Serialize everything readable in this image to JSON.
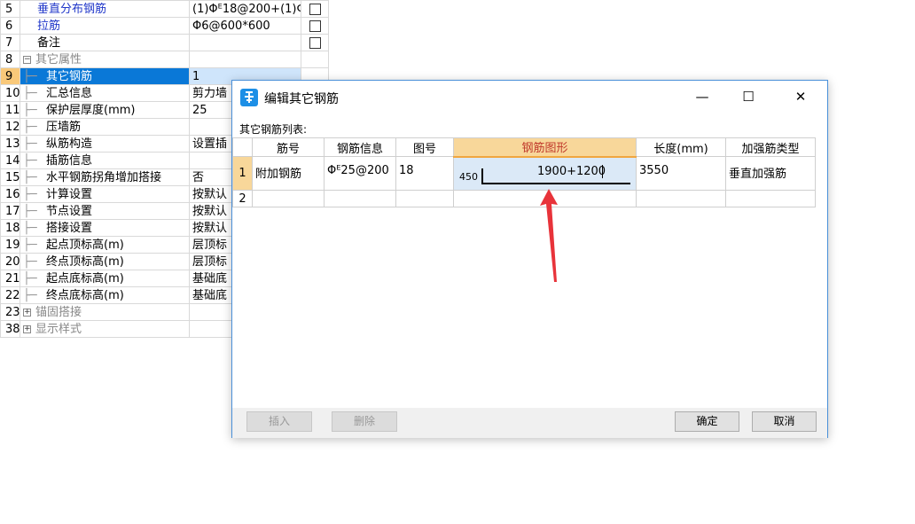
{
  "properties": [
    {
      "num": "5",
      "name": "垂直分布钢筋",
      "value": "(1)Φᴱ18@200+(1)Φ",
      "checkbox": true,
      "style": "blue",
      "indent": 1
    },
    {
      "num": "6",
      "name": "拉筋",
      "value": "Φ6@600*600",
      "checkbox": true,
      "style": "blue",
      "indent": 1
    },
    {
      "num": "7",
      "name": "备注",
      "value": "",
      "checkbox": true,
      "style": "normal",
      "indent": 1
    },
    {
      "num": "8",
      "name": "其它属性",
      "value": "",
      "checkbox": false,
      "style": "group-open",
      "indent": 0
    },
    {
      "num": "9",
      "name": "其它钢筋",
      "value": "1",
      "checkbox": false,
      "style": "selected",
      "indent": 2
    },
    {
      "num": "10",
      "name": "汇总信息",
      "value": "剪力墙",
      "checkbox": false,
      "style": "normal",
      "indent": 2
    },
    {
      "num": "11",
      "name": "保护层厚度(mm)",
      "value": "25",
      "checkbox": false,
      "style": "normal",
      "indent": 2
    },
    {
      "num": "12",
      "name": "压墙筋",
      "value": "",
      "checkbox": false,
      "style": "normal",
      "indent": 2
    },
    {
      "num": "13",
      "name": "纵筋构造",
      "value": "设置插",
      "checkbox": false,
      "style": "normal",
      "indent": 2
    },
    {
      "num": "14",
      "name": "插筋信息",
      "value": "",
      "checkbox": false,
      "style": "normal",
      "indent": 2
    },
    {
      "num": "15",
      "name": "水平钢筋拐角增加搭接",
      "value": "否",
      "checkbox": false,
      "style": "normal",
      "indent": 2
    },
    {
      "num": "16",
      "name": "计算设置",
      "value": "按默认",
      "checkbox": false,
      "style": "normal",
      "indent": 2
    },
    {
      "num": "17",
      "name": "节点设置",
      "value": "按默认",
      "checkbox": false,
      "style": "normal",
      "indent": 2
    },
    {
      "num": "18",
      "name": "搭接设置",
      "value": "按默认",
      "checkbox": false,
      "style": "normal",
      "indent": 2
    },
    {
      "num": "19",
      "name": "起点顶标高(m)",
      "value": "层顶标",
      "checkbox": false,
      "style": "normal",
      "indent": 2
    },
    {
      "num": "20",
      "name": "终点顶标高(m)",
      "value": "层顶标",
      "checkbox": false,
      "style": "normal",
      "indent": 2
    },
    {
      "num": "21",
      "name": "起点底标高(m)",
      "value": "基础底",
      "checkbox": false,
      "style": "normal",
      "indent": 2
    },
    {
      "num": "22",
      "name": "终点底标高(m)",
      "value": "基础底",
      "checkbox": false,
      "style": "normal",
      "indent": 2
    },
    {
      "num": "23",
      "name": "锚固搭接",
      "value": "",
      "checkbox": false,
      "style": "group-closed",
      "indent": 0
    },
    {
      "num": "38",
      "name": "显示样式",
      "value": "",
      "checkbox": false,
      "style": "group-closed",
      "indent": 0
    }
  ],
  "dialog": {
    "title": "编辑其它钢筋",
    "minimize_glyph": "—",
    "maximize_glyph": "☐",
    "close_glyph": "✕",
    "caption": "其它钢筋列表:",
    "columns": [
      "筋号",
      "钢筋信息",
      "图号",
      "钢筋图形",
      "长度(mm)",
      "加强筋类型"
    ],
    "rows": [
      {
        "num": "1",
        "bar_no": "附加钢筋",
        "bar_info": "Φᴱ25@200",
        "fig_no": "18",
        "shape_left": "450",
        "shape_label": "1900+1200",
        "length": "3550",
        "type": "垂直加强筋"
      },
      {
        "num": "2",
        "bar_no": "",
        "bar_info": "",
        "fig_no": "",
        "shape_left": "",
        "shape_label": "",
        "length": "",
        "type": ""
      }
    ],
    "buttons": {
      "insert": "插入",
      "delete": "删除",
      "ok": "确定",
      "cancel": "取消"
    }
  },
  "colors": {
    "accent": "#0a78d7",
    "highlight": "#f8d79a",
    "arrow": "#e8333a"
  }
}
